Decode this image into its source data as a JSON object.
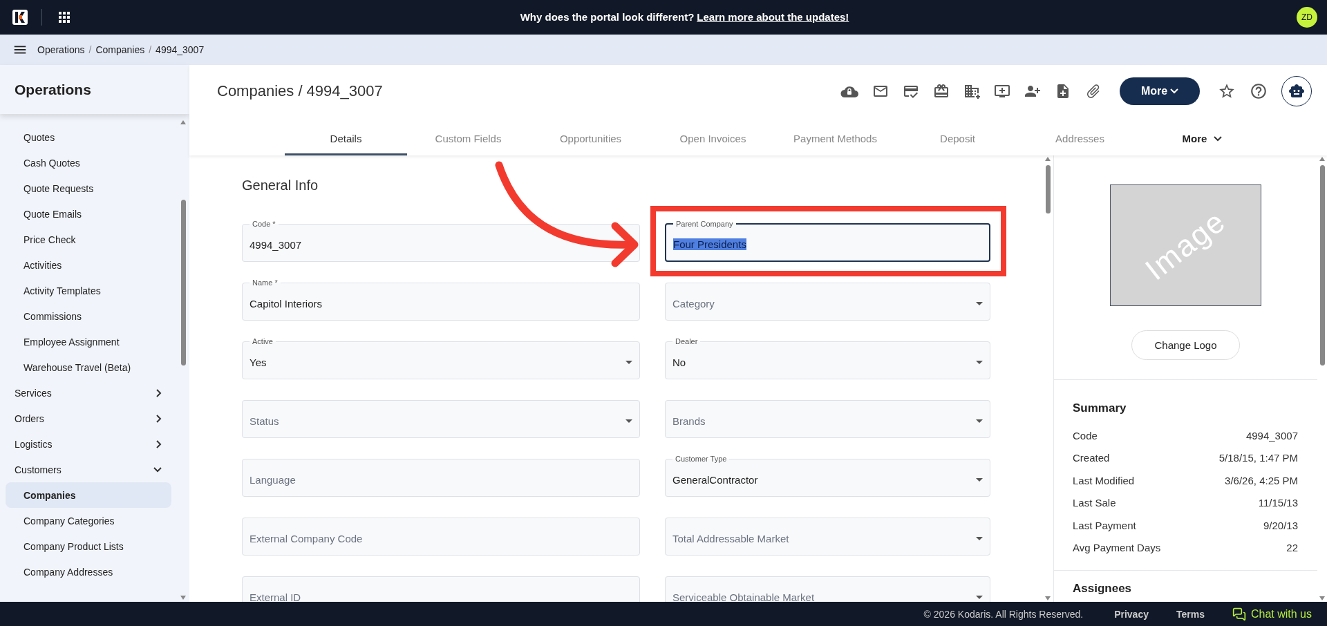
{
  "top_bar": {
    "announcement": "Why does the portal look different?",
    "announcement_link": "Learn more about the updates!",
    "avatar": "ZD"
  },
  "breadcrumb": {
    "separator": "/",
    "items": [
      "Operations",
      "Companies",
      "4994_3007"
    ]
  },
  "sidebar": {
    "title": "Operations",
    "continued_items": [
      {
        "label": "Quotes",
        "selected": false
      },
      {
        "label": "Cash Quotes",
        "selected": false
      },
      {
        "label": "Quote Requests",
        "selected": false
      },
      {
        "label": "Quote Emails",
        "selected": false
      },
      {
        "label": "Price Check",
        "selected": false
      },
      {
        "label": "Activities",
        "selected": false
      },
      {
        "label": "Activity Templates",
        "selected": false
      },
      {
        "label": "Commissions",
        "selected": false
      },
      {
        "label": "Employee Assignment",
        "selected": false
      },
      {
        "label": "Warehouse Travel (Beta)",
        "selected": false
      }
    ],
    "groups": [
      {
        "label": "Services",
        "expanded": false
      },
      {
        "label": "Orders",
        "expanded": false
      },
      {
        "label": "Logistics",
        "expanded": false
      },
      {
        "label": "Customers",
        "expanded": true,
        "children": [
          {
            "label": "Companies",
            "selected": true
          },
          {
            "label": "Company Categories",
            "selected": false
          },
          {
            "label": "Company Product Lists",
            "selected": false
          },
          {
            "label": "Company Addresses",
            "selected": false
          }
        ]
      }
    ]
  },
  "page": {
    "title": "Companies / 4994_3007",
    "more_button": "More",
    "tabs": [
      {
        "label": "Details",
        "kind": "tab",
        "selected": true
      },
      {
        "label": "Custom Fields",
        "kind": "tab",
        "selected": false
      },
      {
        "label": "Opportunities",
        "kind": "tab",
        "selected": false
      },
      {
        "label": "Open Invoices",
        "kind": "tab",
        "selected": false
      },
      {
        "label": "Payment Methods",
        "kind": "tab",
        "selected": false
      },
      {
        "label": "Deposit",
        "kind": "tab",
        "selected": false
      },
      {
        "label": "Addresses",
        "kind": "tab",
        "selected": false
      },
      {
        "label": "More",
        "kind": "menu",
        "selected": false
      }
    ]
  },
  "form": {
    "section_title": "General Info",
    "rows": [
      [
        {
          "kind": "text",
          "label": "Code *",
          "value": "4994_3007",
          "focused": false
        },
        {
          "kind": "text",
          "label": "Parent Company",
          "value": "Four Presidents",
          "focused": true,
          "value_selected": true,
          "annotated": true
        }
      ],
      [
        {
          "kind": "text",
          "label": "Name *",
          "value": "Capitol Interiors",
          "focused": false
        },
        {
          "kind": "select",
          "placeholder": "Category",
          "focused": false
        }
      ],
      [
        {
          "kind": "select",
          "label": "Active",
          "value": "Yes",
          "focused": false
        },
        {
          "kind": "select",
          "label": "Dealer",
          "value": "No",
          "focused": false
        }
      ],
      [
        {
          "kind": "select",
          "placeholder": "Status",
          "focused": false
        },
        {
          "kind": "select",
          "placeholder": "Brands",
          "focused": false
        }
      ],
      [
        {
          "kind": "text",
          "placeholder": "Language",
          "focused": false
        },
        {
          "kind": "select",
          "label": "Customer Type",
          "value": "GeneralContractor",
          "focused": false
        }
      ],
      [
        {
          "kind": "text",
          "placeholder": "External Company Code",
          "focused": false
        },
        {
          "kind": "select",
          "placeholder": "Total Addressable Market",
          "focused": false
        }
      ],
      [
        {
          "kind": "text",
          "placeholder": "External ID",
          "focused": false
        },
        {
          "kind": "select",
          "placeholder": "Serviceable Obtainable Market",
          "focused": false
        }
      ]
    ]
  },
  "logo_panel": {
    "placeholder": "Image",
    "button": "Change Logo"
  },
  "summary": {
    "title": "Summary",
    "rows": [
      {
        "label": "Code",
        "value": "4994_3007"
      },
      {
        "label": "Created",
        "value": "5/18/15, 1:47 PM"
      },
      {
        "label": "Last Modified",
        "value": "3/6/26, 4:25 PM"
      },
      {
        "label": "Last Sale",
        "value": "11/15/13"
      },
      {
        "label": "Last Payment",
        "value": "9/20/13"
      },
      {
        "label": "Avg Payment Days",
        "value": "22"
      }
    ]
  },
  "assignees": {
    "title": "Assignees"
  },
  "footer": {
    "copyright": "© 2026 Kodaris. All Rights Reserved.",
    "links": [
      "Privacy",
      "Terms"
    ],
    "chat": "Chat with us"
  }
}
